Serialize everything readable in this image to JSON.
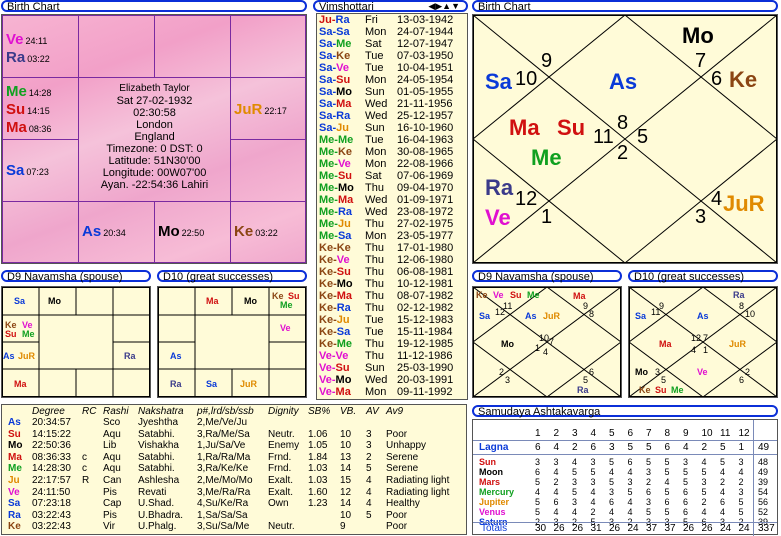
{
  "birth_chart_title": "Birth Chart",
  "vimshottari_title": "Vimshottari",
  "birth_chart_right_title": "Birth Chart",
  "navamsha_title": "D9 Navamsha  (spouse)",
  "d10_title": "D10  (great successes)",
  "navamsha_right_title": "D9 Navamsha  (spouse)",
  "d10_right_title": "D10  (great successes)",
  "ashtaka_title": "Samudaya Ashtakavarga",
  "info": {
    "name": "Elizabeth Taylor",
    "date": "Sat 27-02-1932",
    "time": "02:30:58",
    "city": "London",
    "country": "England",
    "tz": "Timezone: 0 DST: 0",
    "lat": "Latitude: 51N30'00",
    "lon": "Longitude: 00W07'00",
    "ayan": "Ayan. -22:54:36 Lahiri"
  },
  "south_chart": {
    "ve": "Ve",
    "ve_deg": "24:11",
    "ra": "Ra",
    "ra_deg": "03:22",
    "me": "Me",
    "me_deg": "14:28",
    "su": "Su",
    "su_deg": "14:15",
    "ma": "Ma",
    "ma_deg": "08:36",
    "sa": "Sa",
    "sa_deg": "07:23",
    "ju": "JuR",
    "ju_deg": "22:17",
    "as": "As",
    "as_deg": "20:34",
    "mo": "Mo",
    "mo_deg": "22:50",
    "ke": "Ke",
    "ke_deg": "03:22"
  },
  "dasha": [
    {
      "p": "Ju-Ra",
      "c1": "#d01010",
      "c2": "#0a3ad8",
      "d": "Fri",
      "t": "13-03-1942"
    },
    {
      "p": "Sa-Sa",
      "c1": "#0a3ad8",
      "c2": "#0a3ad8",
      "d": "Mon",
      "t": "24-07-1944"
    },
    {
      "p": "Sa-Me",
      "c1": "#0a3ad8",
      "c2": "#10a020",
      "d": "Sat",
      "t": "12-07-1947"
    },
    {
      "p": "Sa-Ke",
      "c1": "#0a3ad8",
      "c2": "#8b4513",
      "d": "Tue",
      "t": "07-03-1950"
    },
    {
      "p": "Sa-Ve",
      "c1": "#0a3ad8",
      "c2": "#e010d0",
      "d": "Tue",
      "t": "10-04-1951"
    },
    {
      "p": "Sa-Su",
      "c1": "#0a3ad8",
      "c2": "#d01010",
      "d": "Mon",
      "t": "24-05-1954"
    },
    {
      "p": "Sa-Mo",
      "c1": "#0a3ad8",
      "c2": "#000000",
      "d": "Sun",
      "t": "01-05-1955"
    },
    {
      "p": "Sa-Ma",
      "c1": "#0a3ad8",
      "c2": "#d01010",
      "d": "Wed",
      "t": "21-11-1956"
    },
    {
      "p": "Sa-Ra",
      "c1": "#0a3ad8",
      "c2": "#0a3ad8",
      "d": "Wed",
      "t": "25-12-1957"
    },
    {
      "p": "Sa-Ju",
      "c1": "#0a3ad8",
      "c2": "#e08a00",
      "d": "Sun",
      "t": "16-10-1960"
    },
    {
      "p": "Me-Me",
      "c1": "#10a020",
      "c2": "#10a020",
      "d": "Tue",
      "t": "16-04-1963"
    },
    {
      "p": "Me-Ke",
      "c1": "#10a020",
      "c2": "#8b4513",
      "d": "Mon",
      "t": "30-08-1965"
    },
    {
      "p": "Me-Ve",
      "c1": "#10a020",
      "c2": "#e010d0",
      "d": "Mon",
      "t": "22-08-1966"
    },
    {
      "p": "Me-Su",
      "c1": "#10a020",
      "c2": "#d01010",
      "d": "Sat",
      "t": "07-06-1969"
    },
    {
      "p": "Me-Mo",
      "c1": "#10a020",
      "c2": "#000000",
      "d": "Thu",
      "t": "09-04-1970"
    },
    {
      "p": "Me-Ma",
      "c1": "#10a020",
      "c2": "#d01010",
      "d": "Wed",
      "t": "01-09-1971"
    },
    {
      "p": "Me-Ra",
      "c1": "#10a020",
      "c2": "#0a3ad8",
      "d": "Wed",
      "t": "23-08-1972"
    },
    {
      "p": "Me-Ju",
      "c1": "#10a020",
      "c2": "#e08a00",
      "d": "Thu",
      "t": "27-02-1975"
    },
    {
      "p": "Me-Sa",
      "c1": "#10a020",
      "c2": "#0a3ad8",
      "d": "Mon",
      "t": "23-05-1977"
    },
    {
      "p": "Ke-Ke",
      "c1": "#8b4513",
      "c2": "#8b4513",
      "d": "Thu",
      "t": "17-01-1980"
    },
    {
      "p": "Ke-Ve",
      "c1": "#8b4513",
      "c2": "#e010d0",
      "d": "Thu",
      "t": "12-06-1980"
    },
    {
      "p": "Ke-Su",
      "c1": "#8b4513",
      "c2": "#d01010",
      "d": "Thu",
      "t": "06-08-1981"
    },
    {
      "p": "Ke-Mo",
      "c1": "#8b4513",
      "c2": "#000000",
      "d": "Thu",
      "t": "10-12-1981"
    },
    {
      "p": "Ke-Ma",
      "c1": "#8b4513",
      "c2": "#d01010",
      "d": "Thu",
      "t": "08-07-1982"
    },
    {
      "p": "Ke-Ra",
      "c1": "#8b4513",
      "c2": "#0a3ad8",
      "d": "Thu",
      "t": "02-12-1982"
    },
    {
      "p": "Ke-Ju",
      "c1": "#8b4513",
      "c2": "#e08a00",
      "d": "Tue",
      "t": "15-12-1983"
    },
    {
      "p": "Ke-Sa",
      "c1": "#8b4513",
      "c2": "#0a3ad8",
      "d": "Tue",
      "t": "15-11-1984"
    },
    {
      "p": "Ke-Me",
      "c1": "#8b4513",
      "c2": "#10a020",
      "d": "Thu",
      "t": "19-12-1985"
    },
    {
      "p": "Ve-Ve",
      "c1": "#e010d0",
      "c2": "#e010d0",
      "d": "Thu",
      "t": "11-12-1986"
    },
    {
      "p": "Ve-Su",
      "c1": "#e010d0",
      "c2": "#d01010",
      "d": "Sun",
      "t": "25-03-1990"
    },
    {
      "p": "Ve-Mo",
      "c1": "#e010d0",
      "c2": "#000000",
      "d": "Wed",
      "t": "20-03-1991"
    },
    {
      "p": "Ve-Ma",
      "c1": "#e010d0",
      "c2": "#d01010",
      "d": "Mon",
      "t": "09-11-1992"
    }
  ],
  "north_chart": {
    "mo": "Mo",
    "n7": "7",
    "n6": "6",
    "ke": "Ke",
    "sa": "Sa",
    "n10": "10",
    "n9": "9",
    "as": "As",
    "ma": "Ma",
    "su": "Su",
    "n11": "11",
    "n8": "8",
    "n5": "5",
    "n2": "2",
    "me": "Me",
    "ra": "Ra",
    "ve": "Ve",
    "n12": "12",
    "n1": "1",
    "n3": "3",
    "n4": "4",
    "ju": "JuR"
  },
  "nav": {
    "sa": "Sa",
    "mo": "Mo",
    "ke": "Ke",
    "ve": "Ve",
    "su": "Su",
    "me": "Me",
    "as": "As",
    "ju": "JuR",
    "ra": "Ra",
    "ma": "Ma"
  },
  "d10": {
    "ma": "Ma",
    "mo": "Mo",
    "ke": "Ke",
    "su": "Su",
    "me": "Me",
    "ve": "Ve",
    "as": "As",
    "ra": "Ra",
    "sa": "Sa",
    "ju": "JuR"
  },
  "nav_n": {
    "ke": "Ke",
    "ve": "Ve",
    "su": "Su",
    "me": "Me",
    "ma": "Ma",
    "sa": "Sa",
    "as": "As",
    "ju": "JuR",
    "mo": "Mo",
    "ra": "Ra",
    "n1": "11",
    "n2": "9",
    "n3": "12",
    "n4": "8",
    "n5": "10",
    "n6": "1",
    "n7": "7",
    "n8": "4",
    "n9": "2",
    "n10": "6",
    "n11": "3",
    "n12": "5"
  },
  "d10_n": {
    "ra": "Ra",
    "sa": "Sa",
    "as": "As",
    "ma": "Ma",
    "ju": "JuR",
    "mo": "Mo",
    "ve": "Ve",
    "ke": "Ke",
    "su": "Su",
    "me": "Me",
    "n1": "9",
    "n2": "8",
    "n3": "11",
    "n4": "10",
    "n5": "12",
    "n6": "7",
    "n7": "4",
    "n8": "1",
    "n9": "3",
    "n10": "2",
    "n11": "5",
    "n12": "6"
  },
  "table": {
    "headers": [
      "Degree",
      "RC",
      "Rashi",
      "Nakshatra",
      "p#,lrd/sb/ssb",
      "Dignity",
      "SB%",
      "VB.",
      "AV",
      "Av9"
    ],
    "rows": [
      {
        "pl": "As",
        "c": "#0a3ad8",
        "deg": "20:34:57",
        "rc": "",
        "ra": "Sco",
        "nk": "Jyeshtha",
        "lrd": "2,Me/Ve/Ju",
        "dg": "",
        "sb": "",
        "vb": "",
        "av": "",
        "av9": ""
      },
      {
        "pl": "Su",
        "c": "#d01010",
        "deg": "14:15:22",
        "rc": "",
        "ra": "Aqu",
        "nk": "Satabhi.",
        "lrd": "3,Ra/Me/Sa",
        "dg": "Neutr.",
        "sb": "1.06",
        "vb": "10",
        "av": "3",
        "av9": "Poor"
      },
      {
        "pl": "Mo",
        "c": "#000000",
        "deg": "22:50:36",
        "rc": "",
        "ra": "Lib",
        "nk": "Vishakha",
        "lrd": "1,Ju/Sa/Ve",
        "dg": "Enemy",
        "sb": "1.05",
        "vb": "10",
        "av": "3",
        "av9": "Unhappy"
      },
      {
        "pl": "Ma",
        "c": "#d01010",
        "deg": "08:36:33",
        "rc": "c",
        "ra": "Aqu",
        "nk": "Satabhi.",
        "lrd": "1,Ra/Ra/Ma",
        "dg": "Frnd.",
        "sb": "1.84",
        "vb": "13",
        "av": "2",
        "av9": "Serene"
      },
      {
        "pl": "Me",
        "c": "#10a020",
        "deg": "14:28:30",
        "rc": "c",
        "ra": "Aqu",
        "nk": "Satabhi.",
        "lrd": "3,Ra/Ke/Ke",
        "dg": "Frnd.",
        "sb": "1.03",
        "vb": "14",
        "av": "5",
        "av9": "Serene"
      },
      {
        "pl": "Ju",
        "c": "#e08a00",
        "deg": "22:17:57",
        "rc": "R",
        "ra": "Can",
        "nk": "Ashlesha",
        "lrd": "2,Me/Mo/Mo",
        "dg": "Exalt.",
        "sb": "1.03",
        "vb": "15",
        "av": "4",
        "av9": "Radiating light"
      },
      {
        "pl": "Ve",
        "c": "#e010d0",
        "deg": "24:11:50",
        "rc": "",
        "ra": "Pis",
        "nk": "Revati",
        "lrd": "3,Me/Ra/Ra",
        "dg": "Exalt.",
        "sb": "1.60",
        "vb": "12",
        "av": "4",
        "av9": "Radiating light"
      },
      {
        "pl": "Sa",
        "c": "#0a3ad8",
        "deg": "07:23:18",
        "rc": "",
        "ra": "Cap",
        "nk": "U.Shad.",
        "lrd": "4,Su/Ke/Ra",
        "dg": "Own",
        "sb": "1.23",
        "vb": "14",
        "av": "4",
        "av9": "Healthy"
      },
      {
        "pl": "Ra",
        "c": "#0a3ad8",
        "deg": "03:22:43",
        "rc": "",
        "ra": "Pis",
        "nk": "U.Bhadra.",
        "lrd": "1,Sa/Sa/Sa",
        "dg": "",
        "sb": "",
        "vb": "10",
        "av": "5",
        "av9": "Poor"
      },
      {
        "pl": "Ke",
        "c": "#8b4513",
        "deg": "03:22:43",
        "rc": "",
        "ra": "Vir",
        "nk": "U.Phalg.",
        "lrd": "3,Su/Sa/Me",
        "dg": "Neutr.",
        "sb": "",
        "vb": "9",
        "av": "",
        "av9": "Poor"
      }
    ]
  },
  "ashtaka": {
    "cols": [
      "1",
      "2",
      "3",
      "4",
      "5",
      "6",
      "7",
      "8",
      "9",
      "10",
      "11",
      "12"
    ],
    "rows": [
      {
        "n": "Lagna",
        "c": "#0a3ad8",
        "v": [
          "6",
          "4",
          "2",
          "6",
          "3",
          "5",
          "5",
          "6",
          "4",
          "2",
          "5",
          "1"
        ],
        "t": "49"
      },
      {
        "n": "Sun",
        "c": "#d01010",
        "v": [
          "3",
          "3",
          "4",
          "3",
          "5",
          "6",
          "5",
          "5",
          "3",
          "4",
          "5",
          "3"
        ],
        "t": "48"
      },
      {
        "n": "Moon",
        "c": "#000000",
        "v": [
          "6",
          "4",
          "5",
          "5",
          "4",
          "4",
          "3",
          "5",
          "5",
          "5",
          "4",
          "4"
        ],
        "t": "49"
      },
      {
        "n": "Mars",
        "c": "#d01010",
        "v": [
          "5",
          "2",
          "3",
          "3",
          "5",
          "3",
          "2",
          "4",
          "5",
          "3",
          "2",
          "2"
        ],
        "t": "39"
      },
      {
        "n": "Mercury",
        "c": "#10a020",
        "v": [
          "4",
          "4",
          "5",
          "4",
          "3",
          "5",
          "6",
          "5",
          "6",
          "5",
          "4",
          "3"
        ],
        "t": "54"
      },
      {
        "n": "Jupiter",
        "c": "#e08a00",
        "v": [
          "5",
          "6",
          "3",
          "4",
          "6",
          "4",
          "3",
          "6",
          "6",
          "2",
          "6",
          "5"
        ],
        "t": "56"
      },
      {
        "n": "Venus",
        "c": "#e010d0",
        "v": [
          "5",
          "4",
          "4",
          "2",
          "4",
          "4",
          "5",
          "5",
          "6",
          "4",
          "4",
          "5"
        ],
        "t": "52"
      },
      {
        "n": "Saturn",
        "c": "#0a3ad8",
        "v": [
          "2",
          "3",
          "2",
          "5",
          "3",
          "2",
          "3",
          "3",
          "5",
          "6",
          "3",
          "2"
        ],
        "t": "39"
      }
    ],
    "totals_label": "Totals",
    "totals": [
      "30",
      "26",
      "26",
      "31",
      "26",
      "24",
      "37",
      "37",
      "26",
      "26",
      "24",
      "24"
    ],
    "grand": "337"
  }
}
